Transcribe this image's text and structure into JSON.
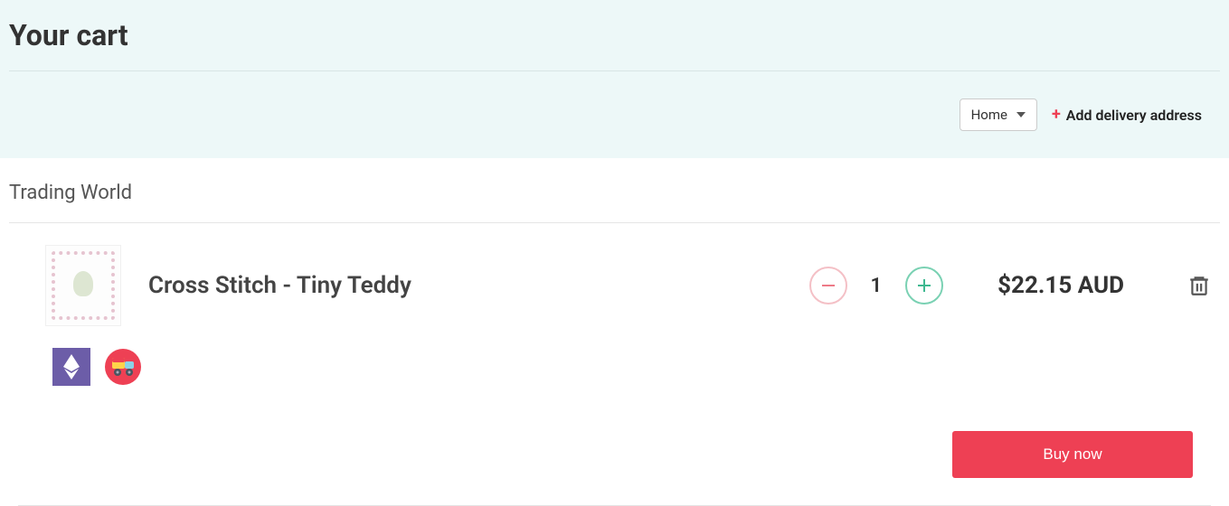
{
  "header": {
    "title": "Your cart"
  },
  "delivery": {
    "dropdown_selected": "Home",
    "add_address_label": "Add delivery address"
  },
  "vendor": {
    "name": "Trading World"
  },
  "item": {
    "name": "Cross Stitch - Tiny Teddy",
    "quantity": "1",
    "price": "$22.15 AUD"
  },
  "actions": {
    "buy_now": "Buy now"
  }
}
